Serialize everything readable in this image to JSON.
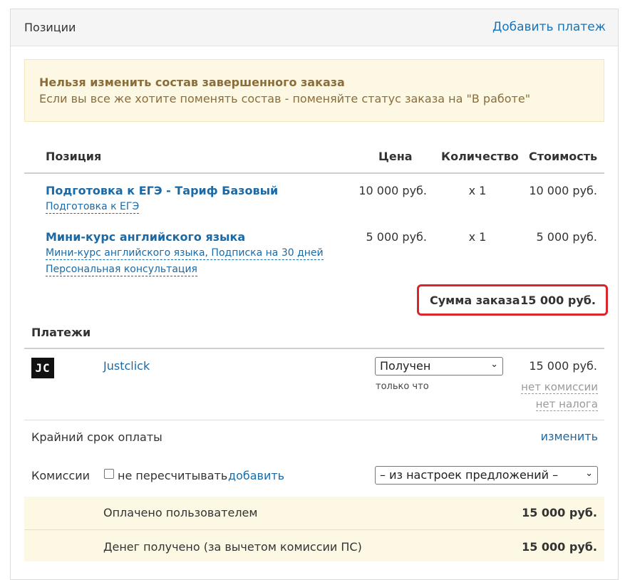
{
  "panel": {
    "title": "Позиции",
    "add_payment_link": "Добавить платеж"
  },
  "alert": {
    "title": "Нельзя изменить состав завершенного заказа",
    "text": "Если вы все же хотите поменять состав - поменяйте статус заказа на \"В работе\""
  },
  "table": {
    "headers": {
      "position": "Позиция",
      "price": "Цена",
      "quantity": "Количество",
      "cost": "Стоимость"
    },
    "rows": [
      {
        "name": "Подготовка к ЕГЭ - Тариф Базовый",
        "subs": [
          "Подготовка к ЕГЭ"
        ],
        "price": "10 000 руб.",
        "qty": "x 1",
        "cost": "10 000 руб."
      },
      {
        "name": "Мини-курс английского языка",
        "subs": [
          "Мини-курс английского языка, Подписка на 30 дней",
          "Персональная консультация"
        ],
        "price": "5 000 руб.",
        "qty": "x 1",
        "cost": "5 000 руб."
      }
    ],
    "total_label": "Сумма заказа",
    "total_value": "15 000 руб."
  },
  "payments": {
    "title": "Платежи",
    "items": [
      {
        "logo_text": "JC",
        "name": "Justclick",
        "status": "Получен",
        "status_note": "только что",
        "amount": "15 000 руб.",
        "commission": "нет комиссии",
        "tax": "нет налога"
      }
    ],
    "deadline_label": "Крайний срок оплаты",
    "deadline_change": "изменить",
    "commissions_label": "Комиссии",
    "no_recalc_label": "не пересчитывать",
    "add_link": "добавить",
    "commission_select": "– из настроек предложений –",
    "paid_label": "Оплачено пользователем",
    "paid_value": "15 000 руб.",
    "received_label": "Денег получено (за вычетом комиссии ПС)",
    "received_value": "15 000 руб."
  },
  "colors": {
    "link": "#1a6aa8",
    "alert_bg": "#fcf8e3",
    "alert_text": "#8a6d3b",
    "highlight_border": "#d9262b"
  }
}
